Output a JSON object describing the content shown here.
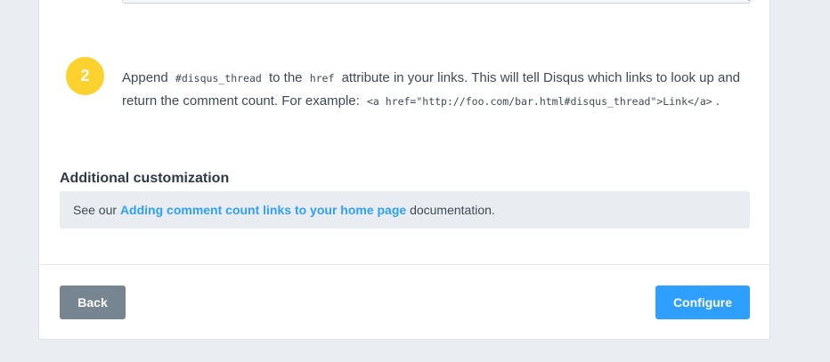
{
  "step": {
    "number": "2",
    "text_1": "Append",
    "code_1": "#disqus_thread",
    "text_2": "to the",
    "code_2": "href",
    "text_3": "attribute in your links. This will tell Disqus which links to look up and return the comment count. For example:",
    "code_3": "<a href=\"http://foo.com/bar.html#disqus_thread\">Link</a>",
    "text_4": "."
  },
  "customization": {
    "title": "Additional customization",
    "prefix": "See our",
    "link": "Adding comment count links to your home page",
    "suffix": "documentation."
  },
  "footer": {
    "back_label": "Back",
    "configure_label": "Configure"
  },
  "colors": {
    "accent": "#2e9fff",
    "badge": "#fdd12e",
    "back_button": "#778591"
  }
}
